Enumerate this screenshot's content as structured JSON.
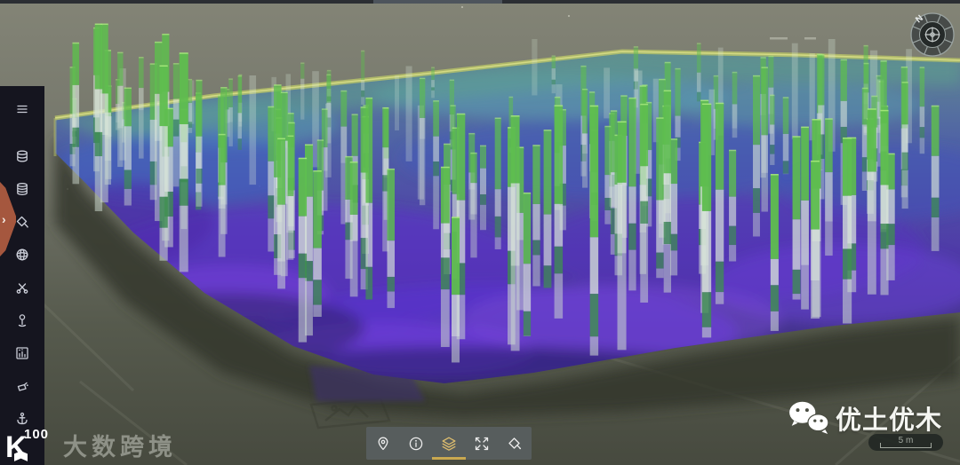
{
  "compass": {
    "north_label": "N"
  },
  "sidebar": {
    "expand_tab": "›",
    "items": [
      {
        "name": "menu"
      },
      {
        "name": "borehole-database"
      },
      {
        "name": "strata-database"
      },
      {
        "name": "fill-style"
      },
      {
        "name": "model-sphere"
      },
      {
        "name": "clip"
      },
      {
        "name": "marker-pin"
      },
      {
        "name": "section-chart"
      },
      {
        "name": "pour-fill"
      },
      {
        "name": "anchor"
      }
    ]
  },
  "toolbar": {
    "items": [
      {
        "name": "locate-pin",
        "active": false
      },
      {
        "name": "info",
        "active": false
      },
      {
        "name": "layers",
        "active": true
      },
      {
        "name": "fullscreen",
        "active": false
      },
      {
        "name": "fill-color",
        "active": false
      }
    ],
    "active_color": "#c9a850"
  },
  "scale_bar": {
    "label": "5 m"
  },
  "watermark_left": {
    "logo_k": "K",
    "logo_100": "100",
    "text": "大数跨境"
  },
  "watermark_right": {
    "brand": "优土优木",
    "icon": "wechat-icon"
  },
  "scene": {
    "description": "3D geotechnical model: field of borehole columns above translucent purple depth surface on satellite terrain",
    "seed": 42,
    "column_count": 175,
    "colors": {
      "terrain_top": "#838476",
      "terrain_bottom": "#474a3f",
      "rim": "#b9c468",
      "shadow": "#33352b",
      "column_green": "#5fbe4f",
      "column_green_dark": "#3f9150",
      "column_pale": "#d8e5d8",
      "column_pale2": "#ccd8ce",
      "column_cap": "#a5e87a"
    }
  }
}
